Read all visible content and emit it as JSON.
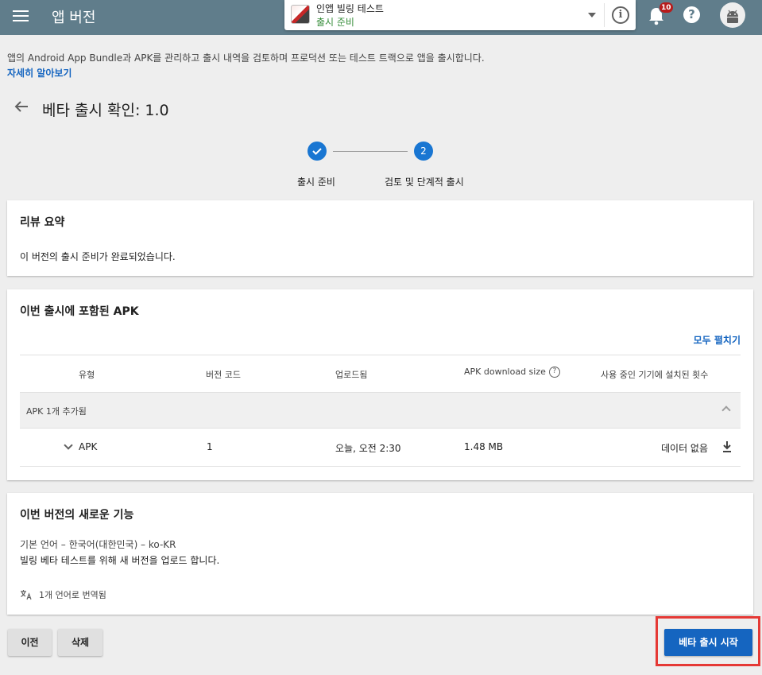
{
  "header": {
    "title": "앱 버전",
    "app_name": "인앱 빌링 테스트",
    "app_status": "출시 준비",
    "notification_count": "10",
    "help_label": "?",
    "info_label": "i"
  },
  "intro": {
    "description": "앱의 Android App Bundle과 APK를 관리하고 출시 내역을 검토하며 프로덕션 또는 테스트 트랙으로 앱을 출시합니다.",
    "learn_more": "자세히 알아보기"
  },
  "page": {
    "title": "베타 출시 확인: 1.0"
  },
  "stepper": {
    "steps": [
      {
        "label": "출시 준비",
        "state": "done"
      },
      {
        "label": "검토 및 단계적 출시",
        "number": "2",
        "state": "active"
      }
    ]
  },
  "review_summary": {
    "title": "리뷰 요약",
    "text": "이 버전의 출시 준비가 완료되었습니다."
  },
  "apk_section": {
    "title": "이번 출시에 포함된 APK",
    "expand_all": "모두 펼치기",
    "columns": [
      "유형",
      "버전 코드",
      "업로드됨",
      "APK download size",
      "사용 중인 기기에 설치된 횟수"
    ],
    "group_label": "APK 1개 추가됨",
    "row": {
      "type": "APK",
      "version_code": "1",
      "uploaded": "오늘, 오전 2:30",
      "size": "1.48 MB",
      "installs": "데이터 없음"
    }
  },
  "whats_new": {
    "title": "이번 버전의 새로운 기능",
    "language": "기본 언어 – 한국어(대한민국) – ko-KR",
    "notes": "빌링 베타 테스트를 위해 새 버전을 업로드 합니다.",
    "translated": "1개 언어로 번역됨"
  },
  "footer": {
    "prev": "이전",
    "delete": "삭제",
    "start": "베타 출시 시작"
  },
  "colors": {
    "topbar": "#607d8b",
    "accent": "#1565c0",
    "status_green": "#388e3c",
    "highlight": "#e53935"
  }
}
